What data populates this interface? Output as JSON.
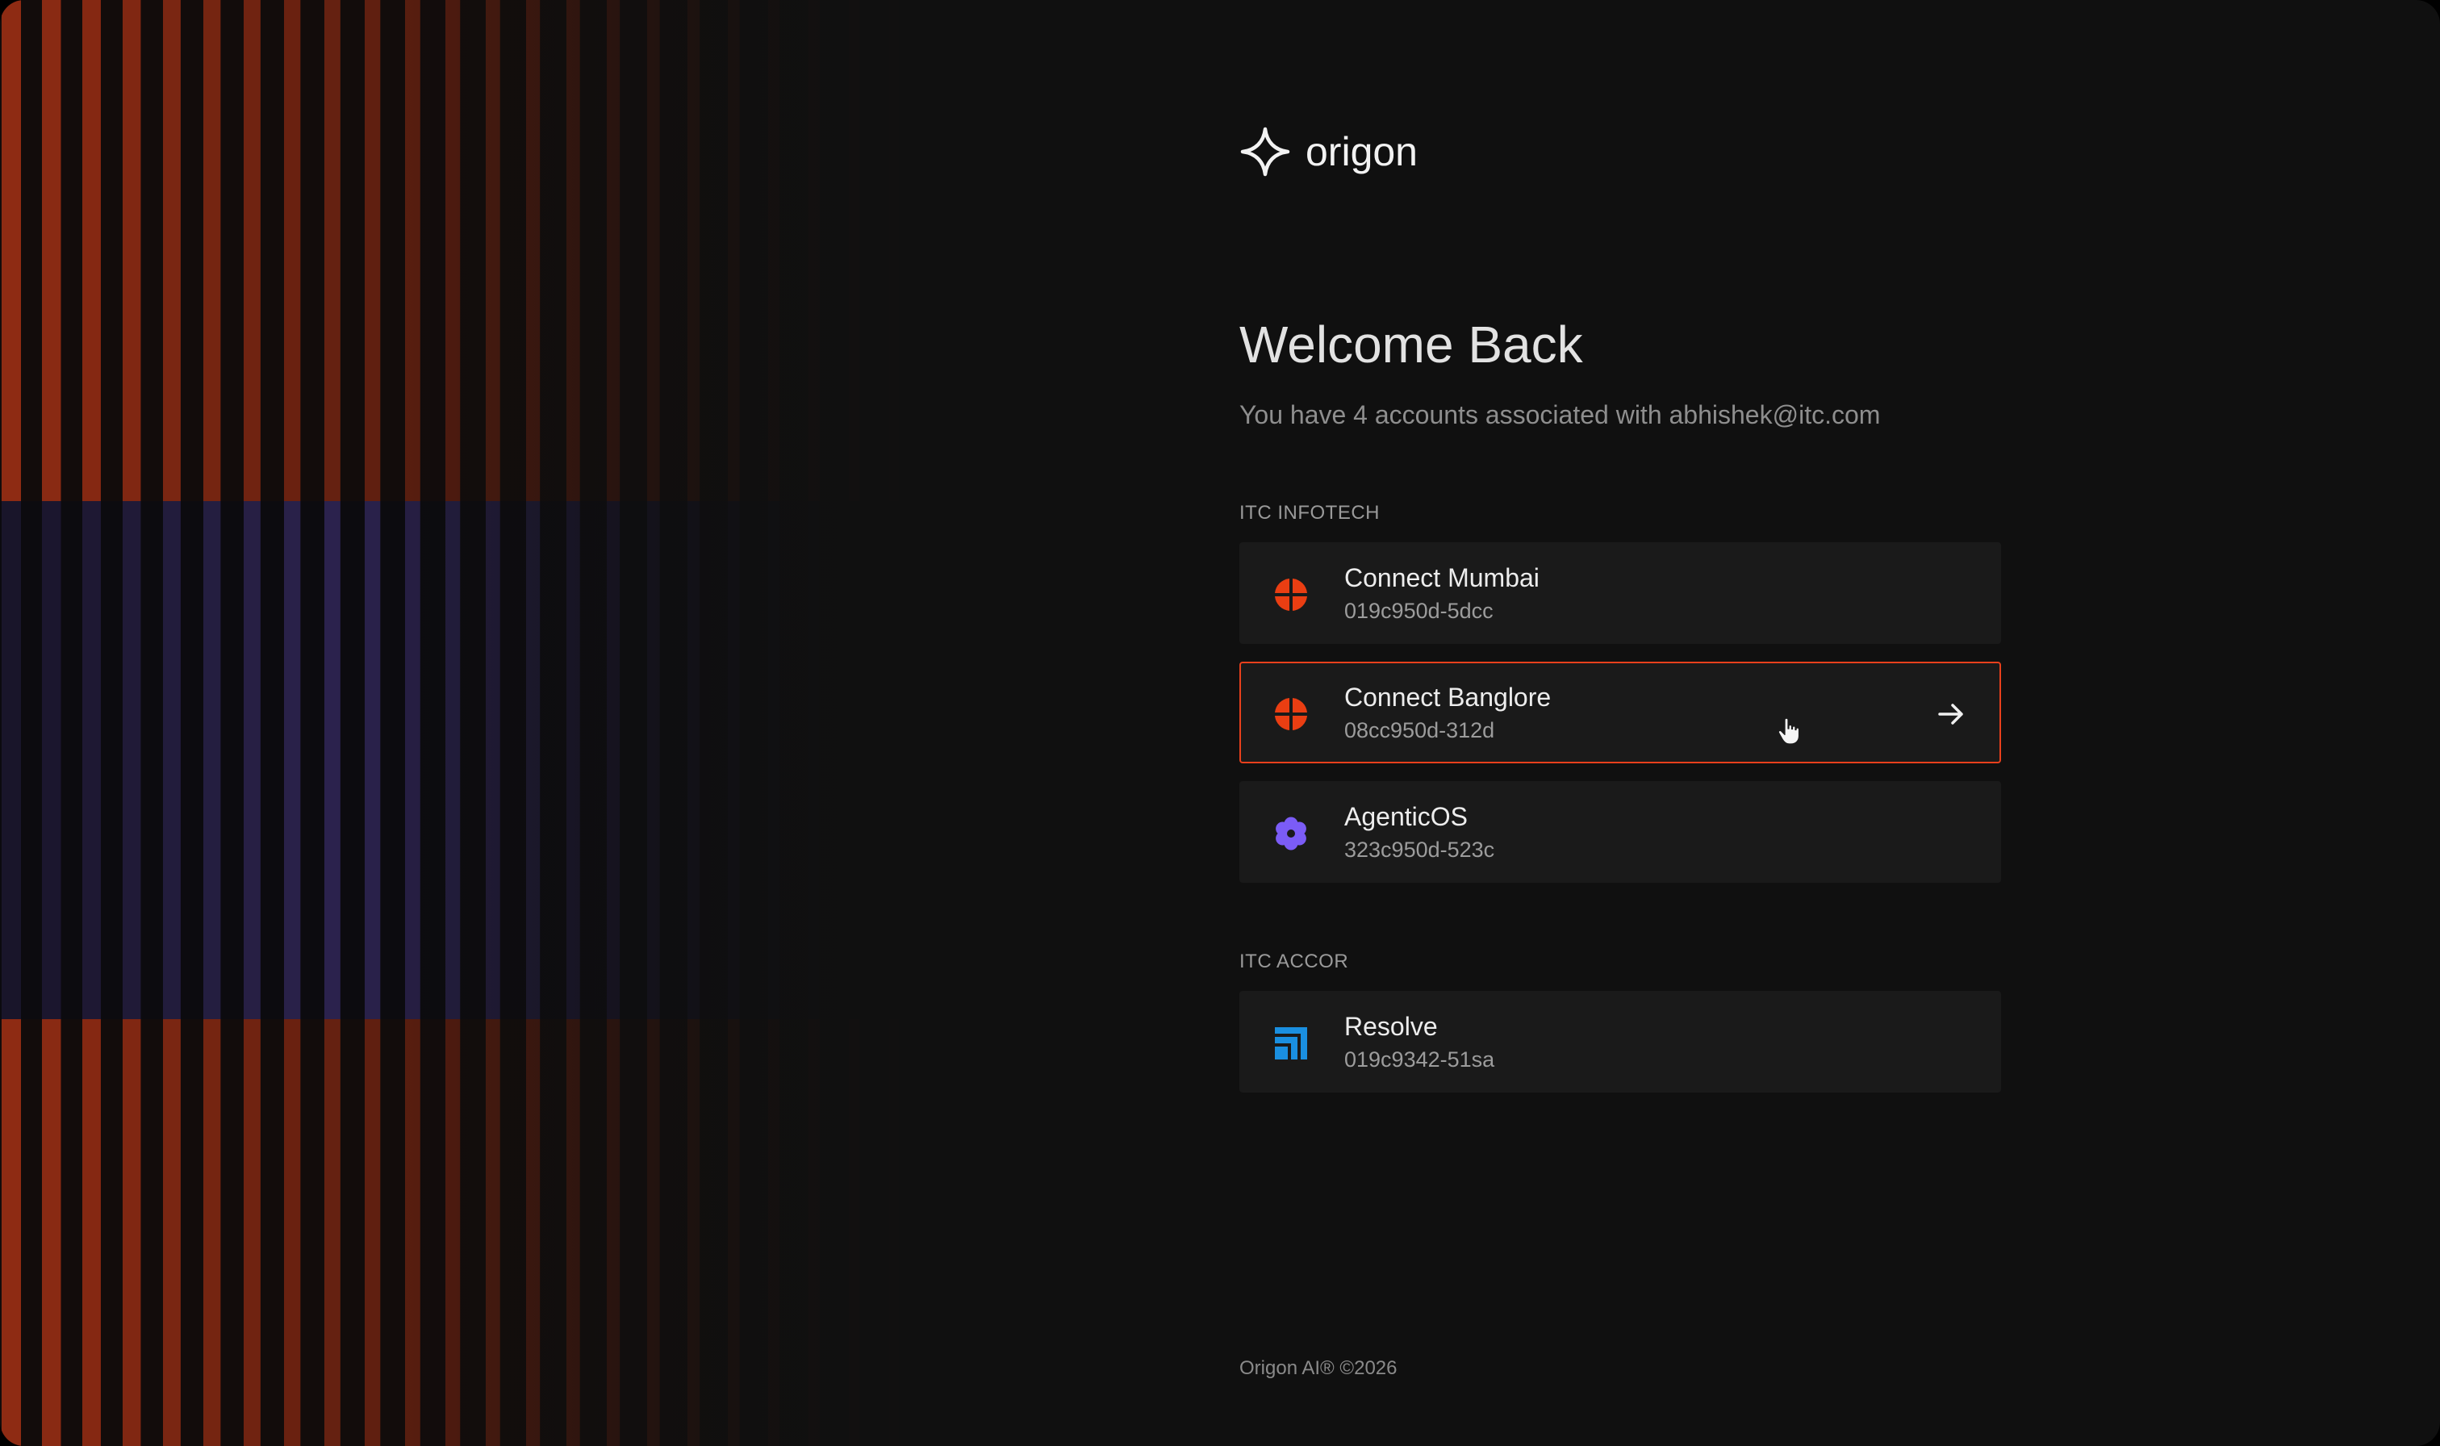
{
  "brand": {
    "name": "origon",
    "icon": "sparkle-star-icon"
  },
  "header": {
    "title": "Welcome Back",
    "subtitle": "You have 4 accounts associated with abhishek@itc.com"
  },
  "groups": [
    {
      "label": "ITC INFOTECH",
      "accounts": [
        {
          "name": "Connect Mumbai",
          "id": "019c950d-5dcc",
          "icon": "connect-logo-icon",
          "color": "#ea3e12",
          "selected": false
        },
        {
          "name": "Connect Banglore",
          "id": "08cc950d-312d",
          "icon": "connect-logo-icon",
          "color": "#ea3e12",
          "selected": true
        },
        {
          "name": "AgenticOS",
          "id": "323c950d-523c",
          "icon": "agenticos-flower-icon",
          "color": "#7b5cf6",
          "selected": false
        }
      ]
    },
    {
      "label": "ITC ACCOR",
      "accounts": [
        {
          "name": "Resolve",
          "id": "019c9342-51sa",
          "icon": "resolve-logo-icon",
          "color": "#1a8fe0",
          "selected": false
        }
      ]
    }
  ],
  "footer": {
    "copyright": "Origon AI® ©2026"
  },
  "colors": {
    "background": "#101010",
    "card": "#1a1a1a",
    "accent": "#e8401c"
  }
}
